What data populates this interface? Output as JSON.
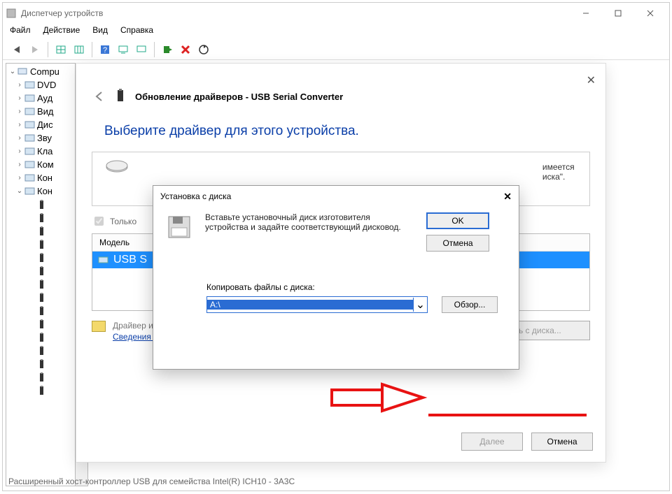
{
  "titlebar": {
    "title": "Диспетчер устройств"
  },
  "menu": {
    "file": "Файл",
    "action": "Действие",
    "view": "Вид",
    "help": "Справка"
  },
  "tree": {
    "root": "Compu",
    "items": [
      {
        "label": "DVD",
        "icon": "disc"
      },
      {
        "label": "Ауд",
        "icon": "speaker"
      },
      {
        "label": "Вид",
        "icon": "display"
      },
      {
        "label": "Дис",
        "icon": "drive"
      },
      {
        "label": "Зву",
        "icon": "speaker"
      },
      {
        "label": "Кла",
        "icon": "keyboard"
      },
      {
        "label": "Ком",
        "icon": "pc"
      },
      {
        "label": "Кон",
        "icon": "card"
      },
      {
        "label": "Кон",
        "icon": "usb",
        "expanded": true
      }
    ],
    "footer": "Расширенный хост-контроллер USB для семейства Intel(R) ICH10 - 3A3C"
  },
  "wizard": {
    "title": "Обновление драйверов - USB Serial Converter",
    "heading": "Выберите драйвер для этого устройства.",
    "panel_text_obscured": "имеется \nиска\".",
    "checkbox": "Только",
    "model_header": "Модель",
    "model_selected": "USB S",
    "signature": "Драйвер имеет цифровую подпись.",
    "signature_link": "Сведения о подписывании драйверов",
    "install_btn": "Установить с диска...",
    "next": "Далее",
    "cancel": "Отмена"
  },
  "modal": {
    "title": "Установка с диска",
    "text": "Вставьте установочный диск изготовителя устройства и задайте соответствующий дисковод.",
    "ok": "OK",
    "cancel": "Отмена",
    "copy_label": "Копировать файлы с диска:",
    "path": "A:\\",
    "browse": "Обзор..."
  }
}
